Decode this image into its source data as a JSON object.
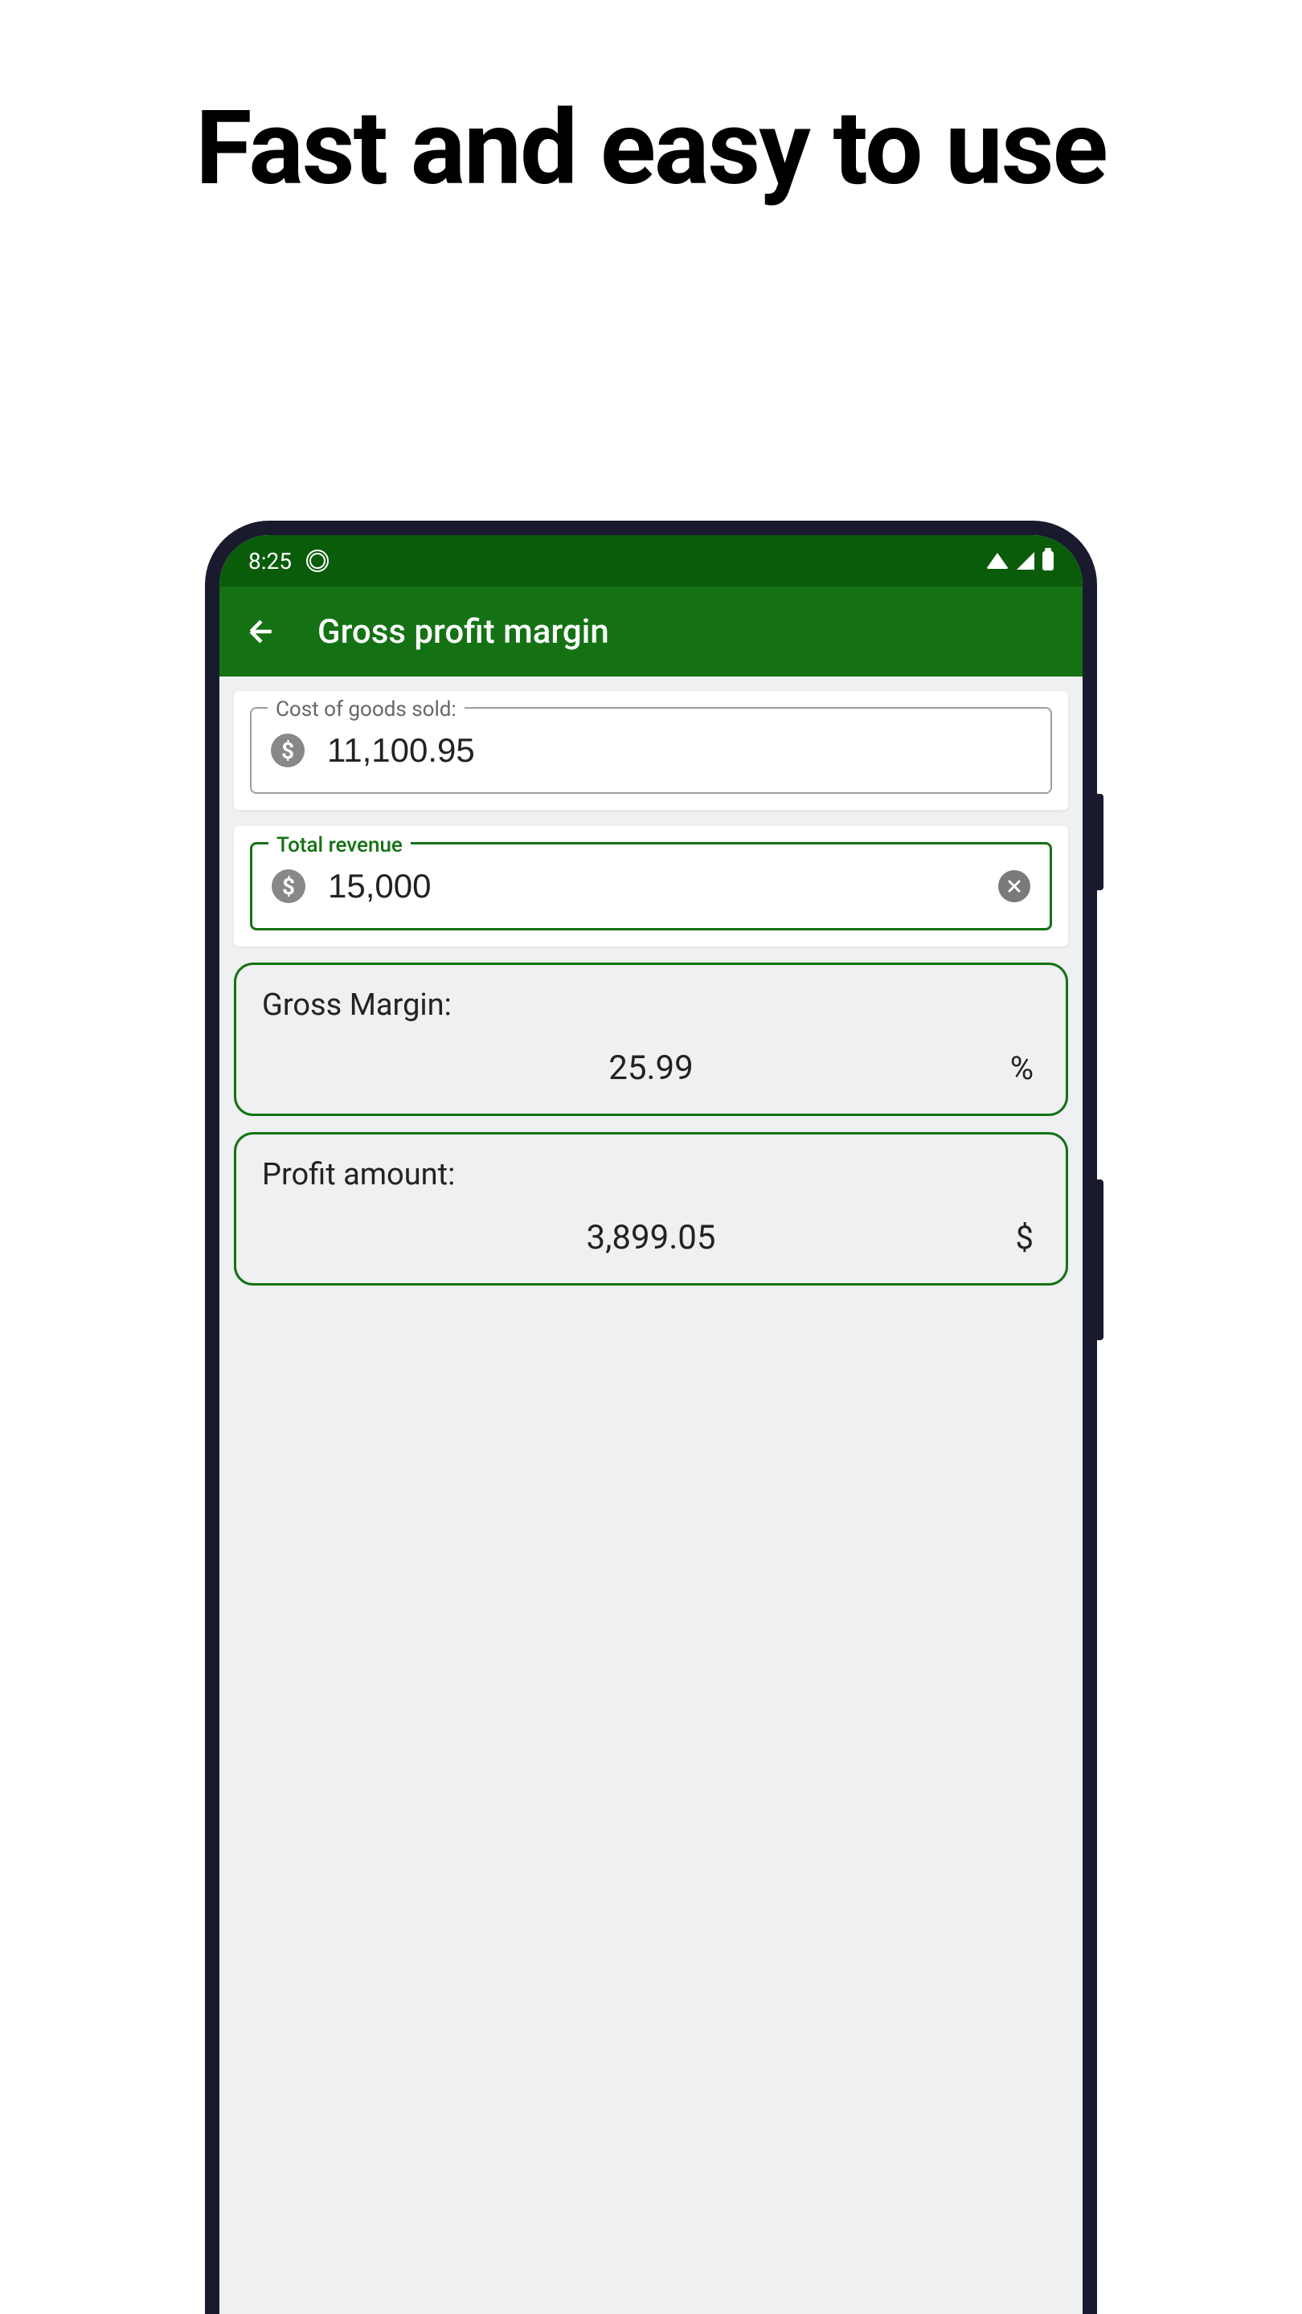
{
  "marketing": {
    "headline": "Fast and easy to use"
  },
  "status_bar": {
    "time": "8:25"
  },
  "app_bar": {
    "title": "Gross profit margin"
  },
  "inputs": {
    "cost": {
      "label": "Cost of goods sold:",
      "value": "11,100.95"
    },
    "revenue": {
      "label": "Total revenue",
      "value": "15,000"
    }
  },
  "results": {
    "margin": {
      "label": "Gross Margin:",
      "value": "25.99",
      "unit": "%"
    },
    "profit": {
      "label": "Profit amount:",
      "value": "3,899.05",
      "unit": "$"
    }
  },
  "colors": {
    "primary_dark": "#0a5c0a",
    "primary": "#147214",
    "background": "#eef0f2"
  }
}
